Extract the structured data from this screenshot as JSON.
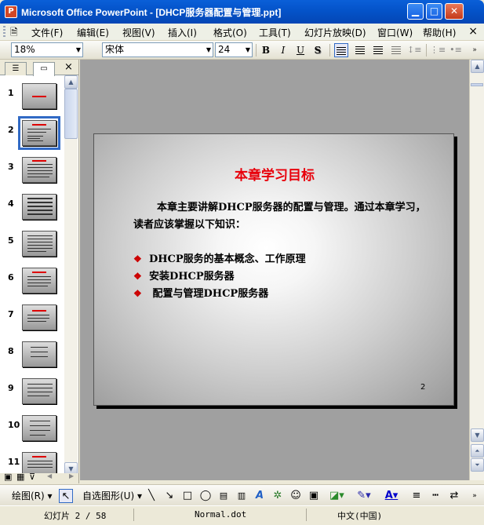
{
  "window": {
    "title": "Microsoft Office PowerPoint - [DHCP服务器配置与管理.ppt]",
    "app_icon_letter": "P",
    "minimize_label": "▁",
    "maximize_label": "□",
    "close_label": "✕"
  },
  "menu": {
    "items": [
      "文件(F)",
      "编辑(E)",
      "视图(V)",
      "插入(I)",
      "格式(O)",
      "工具(T)",
      "幻灯片放映(D)",
      "窗口(W)",
      "帮助(H)"
    ],
    "close_doc": "×"
  },
  "toolbar": {
    "zoom_value": "18%",
    "font_name": "宋体",
    "font_size": "24",
    "bold": "B",
    "italic": "I",
    "underline": "U",
    "shadow": "S"
  },
  "left_panel": {
    "tab_outline_icon": "outline-icon",
    "tab_slides_icon": "slides-icon",
    "close_label": "×",
    "slides": [
      "1",
      "2",
      "3",
      "4",
      "5",
      "6",
      "7",
      "8",
      "9",
      "10",
      "11"
    ],
    "selected_slide": "2"
  },
  "slide": {
    "title": "本章学习目标",
    "paragraph": "本章主要讲解DHCP服务器的配置与管理。通过本章学习，读者应该掌握以下知识：",
    "bullets": [
      "DHCP服务的基本概念、工作原理",
      "安装DHCP服务器",
      " 配置与管理DHCP服务器"
    ],
    "bullet_mark": "❖",
    "number": "2",
    "title_color": "#E8000B"
  },
  "drawbar": {
    "draw_label": "绘图(R)",
    "autoshapes_label": "自选图形(U)"
  },
  "status": {
    "slide_info": "幻灯片 2 / 58",
    "template": "Normal.dot",
    "language": "中文(中国)"
  }
}
